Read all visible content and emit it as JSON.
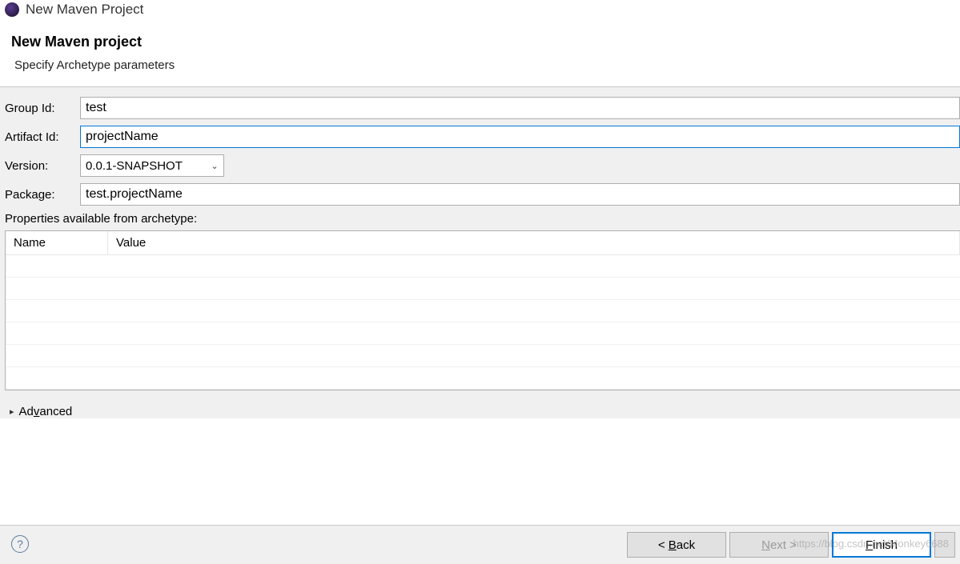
{
  "window": {
    "title": "New Maven Project"
  },
  "header": {
    "title": "New Maven project",
    "subtitle": "Specify Archetype parameters"
  },
  "form": {
    "groupIdLabel": "Group Id:",
    "groupIdValue": "test",
    "artifactIdLabel": "Artifact Id:",
    "artifactIdValue": "projectName",
    "versionLabel": "Version:",
    "versionValue": "0.0.1-SNAPSHOT",
    "packageLabel": "Package:",
    "packageValue": "test.projectName"
  },
  "propertiesLabel": "Properties available from archetype:",
  "tableHeaders": {
    "name": "Name",
    "value": "Value"
  },
  "advanced": {
    "label": "Advanced",
    "expandArrow": "▸"
  },
  "buttons": {
    "back": "< Back",
    "next": "Next >",
    "finish": "Finish"
  },
  "helpGlyph": "?",
  "comboArrow": "⌄",
  "watermark": "https://blog.csdn.net/Monkey6688"
}
